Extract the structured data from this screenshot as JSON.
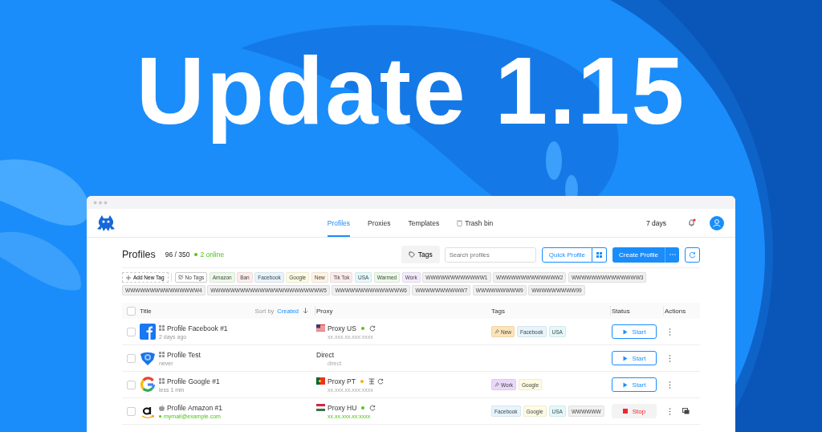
{
  "headline": "Update 1.15",
  "nav": {
    "tabs": [
      {
        "label": "Profiles",
        "selected": true,
        "kind": "plain"
      },
      {
        "label": "Proxies",
        "selected": false,
        "kind": "plain"
      },
      {
        "label": "Templates",
        "selected": false,
        "kind": "plain"
      },
      {
        "label": "Trash bin",
        "selected": false,
        "kind": "trash"
      }
    ],
    "subscription": "7 days",
    "unread_notifications": true
  },
  "page": {
    "title": "Profiles",
    "count": "96 / 350",
    "online": "2 online"
  },
  "toolbar": {
    "tags_button": "Tags",
    "search": {
      "placeholder": "Search profiles"
    },
    "quick_profile": "Quick Profile",
    "create_profile": "Create Profile"
  },
  "tag_filter": {
    "add": "Add New Tag",
    "tags": [
      {
        "label": "No Tags",
        "kind": "none",
        "color": "#ffffff"
      },
      {
        "label": "Amazon",
        "kind": "tag",
        "color": "#ecf8e8"
      },
      {
        "label": "Ban",
        "kind": "tag",
        "color": "#fdecec"
      },
      {
        "label": "Facebook",
        "kind": "tag",
        "color": "#e6f4fd"
      },
      {
        "label": "Google",
        "kind": "tag",
        "color": "#fdfbe2"
      },
      {
        "label": "New",
        "kind": "tag",
        "color": "#fff4e3"
      },
      {
        "label": "Tik Tok",
        "kind": "tag",
        "color": "#fdecec"
      },
      {
        "label": "USA",
        "kind": "tag",
        "color": "#e3f8fb"
      },
      {
        "label": "Warmed",
        "kind": "tag",
        "color": "#ecf8e8"
      },
      {
        "label": "Work",
        "kind": "tag",
        "color": "#f4eafd"
      },
      {
        "label": "WWWWWWWWWWWW1",
        "kind": "tag",
        "color": "#f0f0f0"
      },
      {
        "label": "WWWWWWWWWWWWW2",
        "kind": "tag",
        "color": "#f0f0f0"
      },
      {
        "label": "WWWWWWWWWWWWWW3",
        "kind": "tag",
        "color": "#f0f0f0"
      },
      {
        "label": "WWWWWWWWWWWWWWW4",
        "kind": "tag",
        "color": "#f0f0f0"
      },
      {
        "label": "WWWWWWWWWWWWWWWWWWWWWWW5",
        "kind": "tag",
        "color": "#f0f0f0"
      },
      {
        "label": "WWWWWWWWWWWWWW6",
        "kind": "tag",
        "color": "#f0f0f0"
      },
      {
        "label": "WWWWWWWWWW7",
        "kind": "tag",
        "color": "#f0f0f0"
      },
      {
        "label": "WWWWWWWWW9",
        "kind": "tag",
        "color": "#f0f0f0"
      },
      {
        "label": "WWWWWWWWW99",
        "kind": "tag",
        "color": "#f0f0f0"
      }
    ]
  },
  "table": {
    "all_checked": false,
    "columns": [
      {
        "label": "Title"
      },
      {
        "label": "Proxy"
      },
      {
        "label": "Tags"
      },
      {
        "label": "Status"
      },
      {
        "label": "Actions"
      }
    ],
    "sort": {
      "prefix": "Sort by",
      "field": "Created"
    },
    "rows": [
      {
        "selected": false,
        "logo": {
          "kind": "facebook"
        },
        "os": {
          "kind": "windows"
        },
        "title": "Profile Facebook #1",
        "subtitle": "2 days ago",
        "online": false,
        "proxy": {
          "kind": "proxy",
          "flag": {
            "kind": "us"
          },
          "name": "Proxy US",
          "color": "#52c41a",
          "extra": false,
          "address": "xx.xxx.xx.xxx:xxxx"
        },
        "tags": [
          {
            "label": "New",
            "pinned": true,
            "color": "#fde3b8"
          },
          {
            "label": "Facebook",
            "pinned": false,
            "color": "#e6f4fd"
          },
          {
            "label": "USA",
            "pinned": false,
            "color": "#e3f8fb"
          }
        ],
        "status": {
          "kind": "start",
          "label": "Start"
        },
        "copy": false
      },
      {
        "selected": false,
        "logo": {
          "kind": "shield"
        },
        "os": {
          "kind": "windows"
        },
        "title": "Profile Test",
        "subtitle": "never",
        "online": false,
        "proxy": {
          "kind": "direct",
          "name": "Direct",
          "address": "direct"
        },
        "tags": [],
        "status": {
          "kind": "start",
          "label": "Start"
        },
        "copy": false
      },
      {
        "selected": false,
        "logo": {
          "kind": "google"
        },
        "os": {
          "kind": "windows"
        },
        "title": "Profile Google #1",
        "subtitle": "less 1 min",
        "online": false,
        "proxy": {
          "kind": "proxy",
          "flag": {
            "kind": "pt"
          },
          "name": "Proxy PT",
          "color": "#faad14",
          "extra": true,
          "address": "xx.xxx.xx.xxx:xxxx"
        },
        "tags": [
          {
            "label": "Work",
            "pinned": true,
            "color": "#ead7f9"
          },
          {
            "label": "Google",
            "pinned": false,
            "color": "#fdfbe2"
          }
        ],
        "status": {
          "kind": "start",
          "label": "Start"
        },
        "copy": false
      },
      {
        "selected": false,
        "logo": {
          "kind": "amazon"
        },
        "os": {
          "kind": "apple"
        },
        "title": "Profile Amazon #1",
        "subtitle": "mymail@example.com",
        "online": true,
        "proxy": {
          "kind": "proxy",
          "flag": {
            "kind": "hu"
          },
          "name": "Proxy HU",
          "color": "#52c41a",
          "extra": false,
          "address": "xx.xx.xxx.xx:xxxx"
        },
        "tags": [
          {
            "label": "Facebook",
            "pinned": false,
            "color": "#e6f4fd"
          },
          {
            "label": "Google",
            "pinned": false,
            "color": "#fdfbe2"
          },
          {
            "label": "USA",
            "pinned": false,
            "color": "#e3f8fb"
          },
          {
            "label": "WWWWWW",
            "pinned": false,
            "color": "#f0f0f0"
          }
        ],
        "status": {
          "kind": "stop",
          "label": "Stop"
        },
        "copy": true
      }
    ]
  }
}
